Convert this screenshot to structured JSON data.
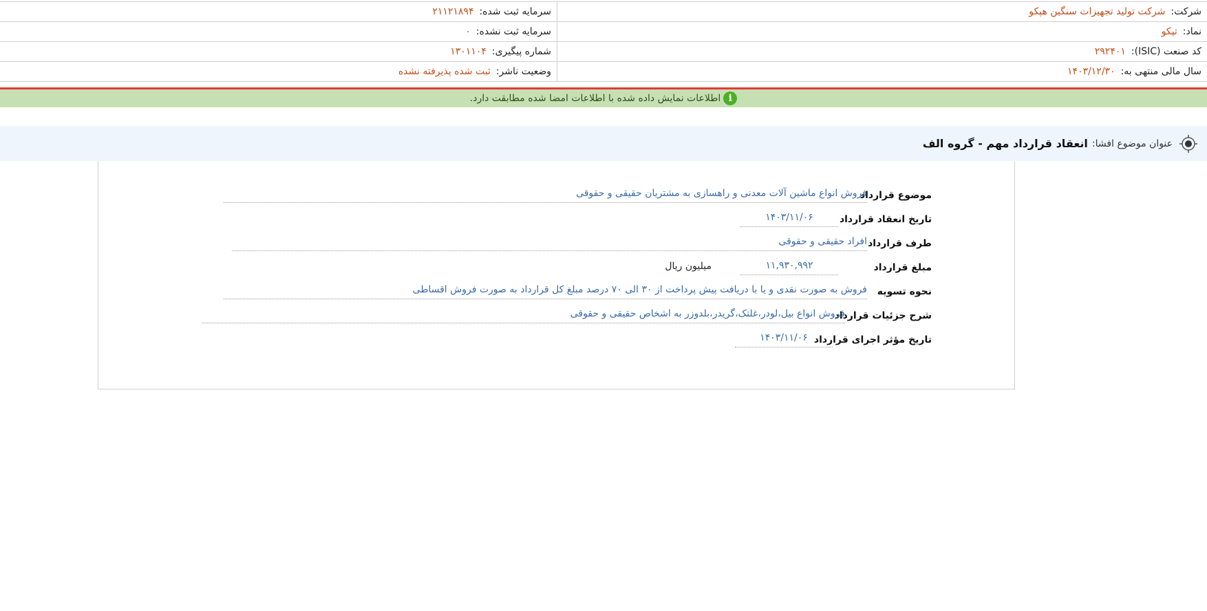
{
  "header": {
    "company_label": "شرکت:",
    "company_value": "شرکت تولید تجهیزات سنگین هپکو",
    "registered_capital_label": "سرمایه ثبت شده:",
    "registered_capital_value": "۲۱۱۲۱۸۹۴",
    "symbol_label": "نماد:",
    "symbol_value": "تپکو",
    "unregistered_capital_label": "سرمایه ثبت نشده:",
    "unregistered_capital_value": "۰",
    "isic_label": "کد صنعت (ISIC):",
    "isic_value": "۲۹۲۴۰۱",
    "tracking_label": "شماره پیگیری:",
    "tracking_value": "۱۳۰۱۱۰۴",
    "fiscal_year_label": "سال مالی منتهی به:",
    "fiscal_year_value": "۱۴۰۳/۱۲/۳۰",
    "publisher_status_label": "وضعیت ناشر:",
    "publisher_status_value": "ثبت شده پذیرفته نشده"
  },
  "notice": {
    "icon": "info-icon",
    "text": "اطلاعات نمایش داده شده با اطلاعات امضا شده مطابقت دارد."
  },
  "subject": {
    "icon": "target-icon",
    "label": "عنوان موضوع افشا:",
    "title": "انعقاد قرارداد مهم - گروه الف"
  },
  "details": {
    "subject_label": "موضوع قرارداد",
    "subject_value": "فروش انواع ماشین آلات معدنی و راهسازی به مشتریان حقیقی و حقوقی",
    "date_label": "تاریخ انعقاد قرارداد",
    "date_value": "۱۴۰۳/۱۱/۰۶",
    "party_label": "طرف قرارداد",
    "party_value": "افراد حقیقی و حقوقی",
    "amount_label": "مبلغ قرارداد",
    "amount_value": "۱۱,۹۳۰,۹۹۲",
    "amount_unit": "میلیون ریال",
    "settlement_label": "نحوه تسویه",
    "settlement_value": "فروش به صورت نقدی و یا با دریافت پیش پرداخت از ۳۰ الی ۷۰ درصد مبلغ کل قرارداد به صورت فروش اقساطی",
    "description_label": "شرح جزئیات قرارداد",
    "description_value": "فروش انواع بیل،لودر،غلتک،گریدر،بلدوزر به اشخاص حقیقی و حقوقی",
    "effective_date_label": "تاریخ مؤثر اجرای قرارداد",
    "effective_date_value": "۱۴۰۳/۱۱/۰۶"
  },
  "colors": {
    "value_orange": "#c0501e",
    "value_blue": "#3b6ca8",
    "notice_green": "#c6e0b4",
    "notice_red_border": "#e53935",
    "subject_bg": "#eef5fc"
  }
}
